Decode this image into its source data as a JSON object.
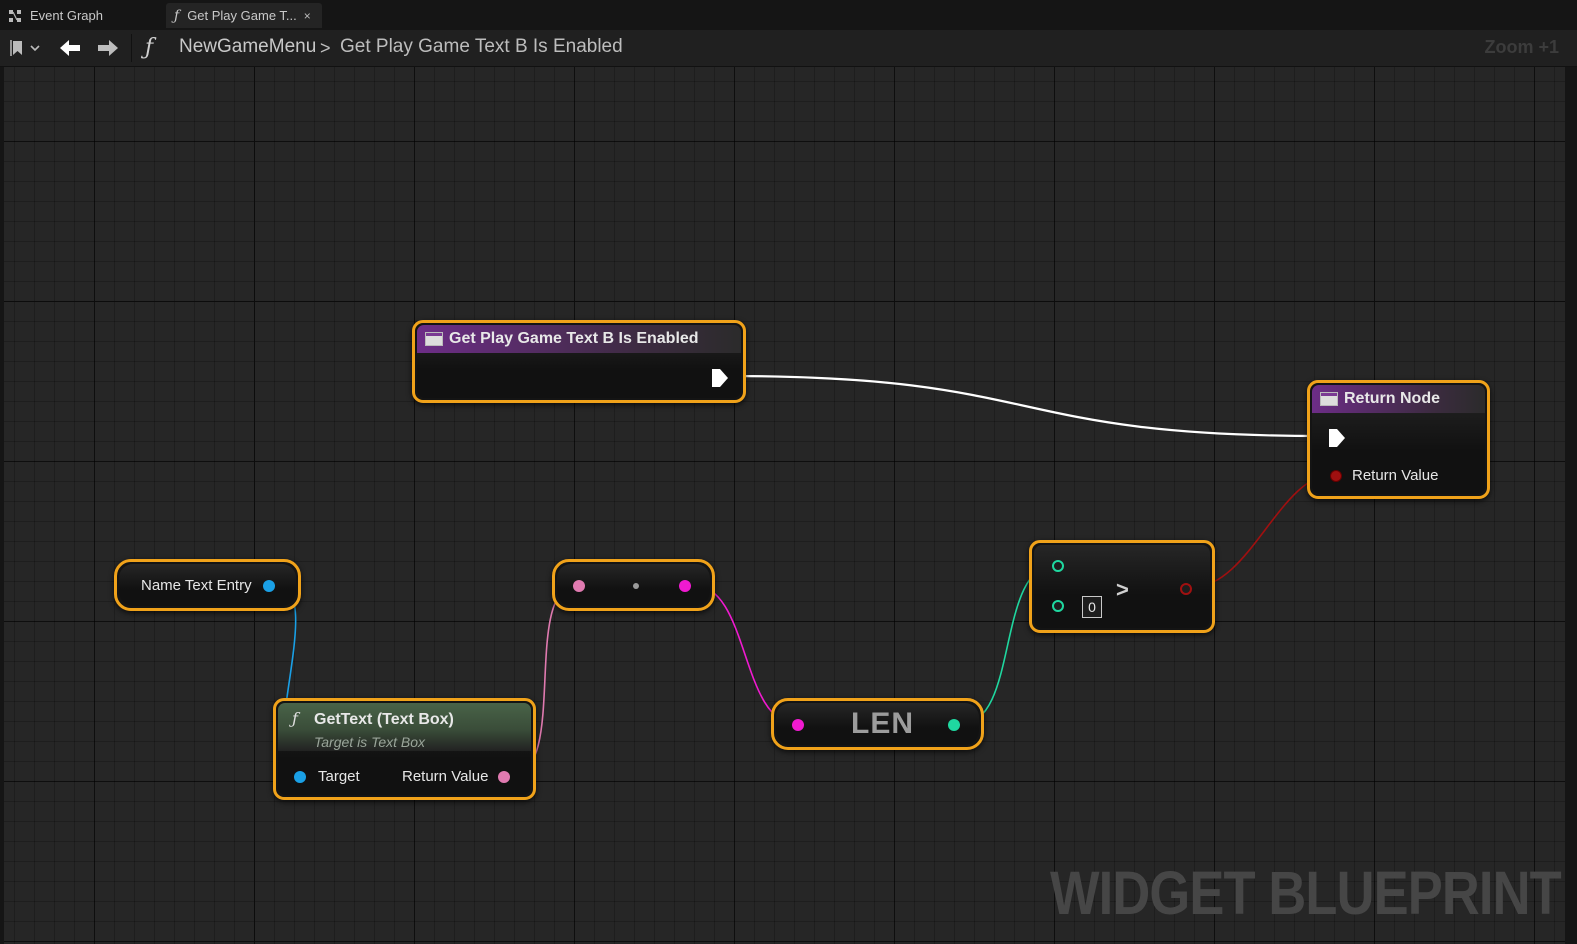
{
  "tabs": [
    {
      "label": "Event Graph",
      "icon": "graph-icon"
    },
    {
      "label": "Get Play Game T...",
      "icon": "function-icon",
      "close": "×"
    }
  ],
  "toolbar": {
    "bookmark_icon": "bookmark-icon",
    "back_icon": "back-arrow-icon",
    "forward_icon": "forward-arrow-icon",
    "function_glyph": "ƒ",
    "breadcrumb": [
      "NewGameMenu",
      "Get Play Game Text B Is Enabled"
    ],
    "separator": ">",
    "zoom": "Zoom +1"
  },
  "nodes": {
    "entry": {
      "title": "Get Play Game Text B Is Enabled",
      "header_color": "#6d2d87"
    },
    "return": {
      "title": "Return Node",
      "pin_return_value": "Return Value",
      "header_color": "#6d2d87"
    },
    "name_text_entry": {
      "label": "Name Text Entry"
    },
    "get_text": {
      "title": "GetText (Text Box)",
      "subtitle": "Target is Text Box",
      "glyph": "ƒ",
      "pin_target": "Target",
      "pin_return_value": "Return Value"
    },
    "conversion": {},
    "len": {
      "label": "LEN"
    },
    "greater": {
      "operator": ">",
      "default_value": "0"
    }
  },
  "colors": {
    "selection_border": "#f0a21a",
    "object_pin": "#1aa0e6",
    "text_pin": "#e07ab0",
    "string_pin": "#f01ad0",
    "int_pin": "#1fd8a0",
    "bool_pin": "#a01010",
    "exec_wire": "#ffffff"
  },
  "watermark": "WIDGET BLUEPRINT"
}
